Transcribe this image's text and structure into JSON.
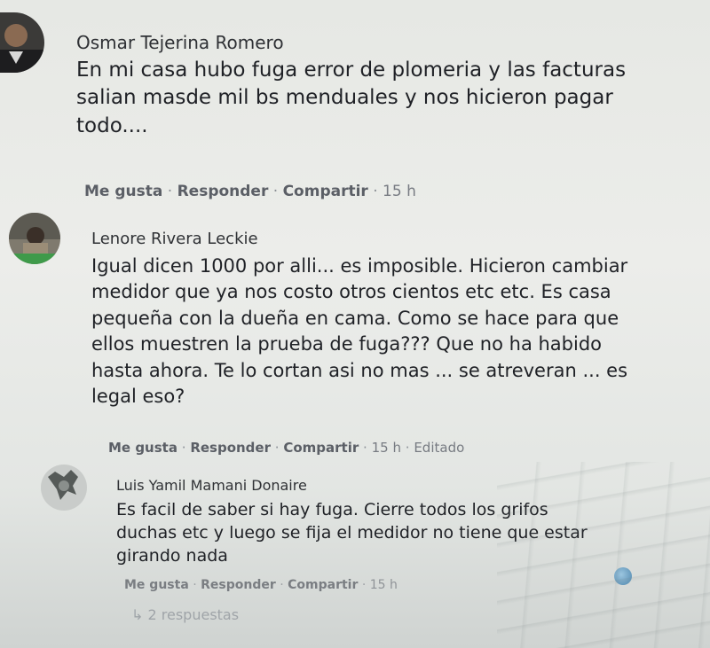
{
  "comments": [
    {
      "author": "Osmar Tejerina Romero",
      "text_lines": [
        "En mi casa hubo fuga error de plomeria y las facturas",
        "salian masde mil bs menduales y nos hicieron pagar",
        "todo...."
      ],
      "actions": {
        "like": "Me gusta",
        "reply": "Responder",
        "share": "Compartir",
        "time": "15 h"
      }
    },
    {
      "author": "Lenore Rivera Leckie",
      "text_lines": [
        "Igual dicen 1000 por alli... es imposible. Hicieron cambiar",
        "medidor que ya nos costo otros cientos etc etc. Es casa",
        "pequeña con la dueña en cama. Como se hace para que",
        "ellos muestren la prueba de fuga??? Que no ha habido",
        "hasta ahora. Te lo cortan asi no mas ... se atreveran ... es",
        "legal eso?"
      ],
      "actions": {
        "like": "Me gusta",
        "reply": "Responder",
        "share": "Compartir",
        "time": "15 h",
        "edited": "Editado"
      }
    },
    {
      "author": "Luis Yamil Mamani Donaire",
      "text_lines": [
        "Es facil de saber si hay fuga. Cierre todos los grifos",
        "duchas etc y luego se fija el medidor no tiene que estar",
        "girando nada"
      ],
      "actions": {
        "like": "Me gusta",
        "reply": "Responder",
        "share": "Compartir",
        "time": "15 h"
      },
      "replies_link": "2 respuestas"
    }
  ],
  "separator": "·",
  "icons": {
    "replies": "reply-arrow-icon",
    "reaction": "like-reaction-icon"
  }
}
